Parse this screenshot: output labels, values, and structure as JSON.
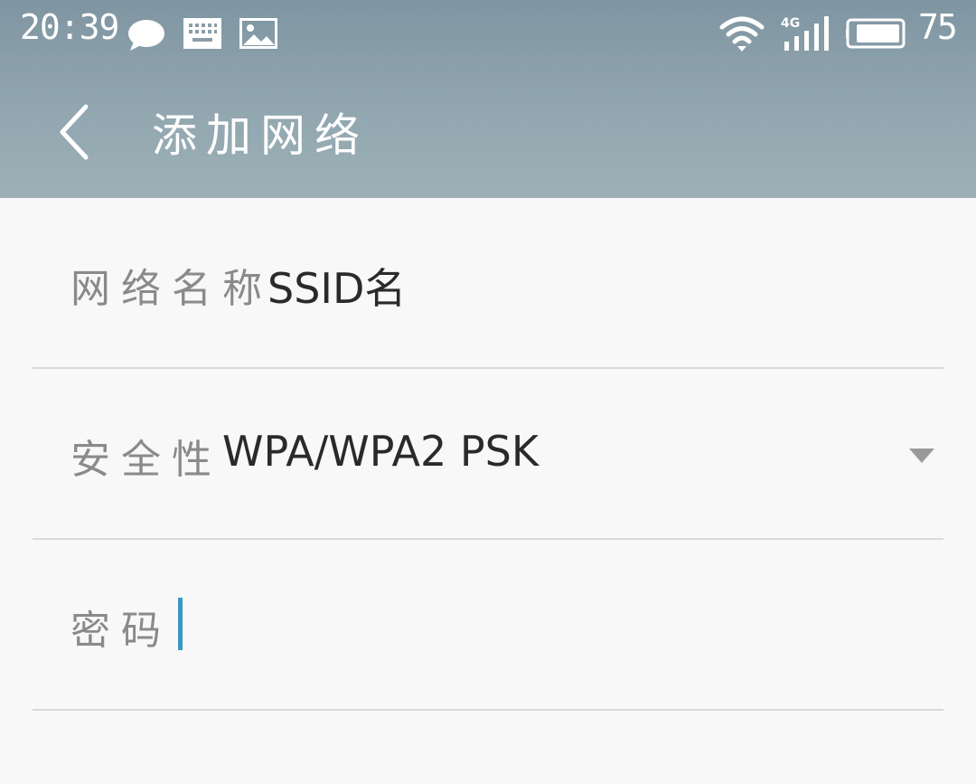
{
  "status_bar": {
    "time": "20:39",
    "icons": [
      "chat-bubble-icon",
      "keyboard-icon",
      "image-icon",
      "wifi-icon",
      "cellular-4g-icon",
      "battery-icon"
    ],
    "network_type": "4G",
    "battery_percent": "75"
  },
  "toolbar": {
    "back_icon": "chevron-left-icon",
    "title": "添加网络"
  },
  "form": {
    "network_name": {
      "label": "网络名称",
      "value": "SSID名"
    },
    "security": {
      "label": "安全性",
      "value": "WPA/WPA2 PSK",
      "icon": "dropdown-triangle-icon"
    },
    "password": {
      "label": "密码",
      "value": ""
    }
  },
  "colors": {
    "header_top": "#7f95a1",
    "header_bottom": "#9db0b6",
    "caret": "#3b97c4",
    "background": "#f8f8f8"
  }
}
